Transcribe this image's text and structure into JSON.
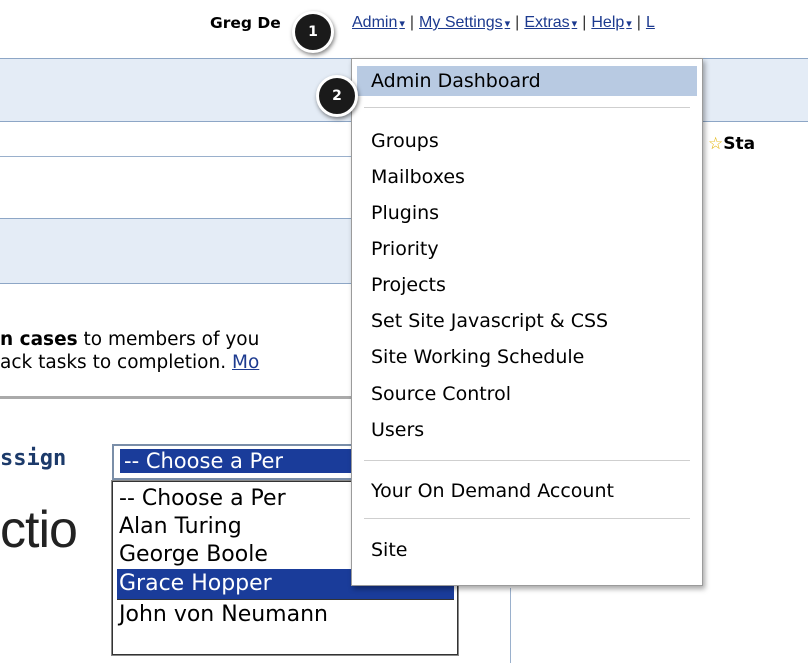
{
  "topnav": {
    "user_name": "Greg De",
    "links": [
      {
        "label": "Admin",
        "caret": "▾"
      },
      {
        "label": "My Settings",
        "caret": "▾"
      },
      {
        "label": "Extras",
        "caret": "▾"
      },
      {
        "label": "Help",
        "caret": "▾"
      },
      {
        "label": "L",
        "caret": ""
      }
    ],
    "separator": "|"
  },
  "toolbar": {
    "caret": "▾",
    "star_label": "Sta"
  },
  "intro": {
    "line1_bold": "n cases",
    "line1_rest": " to members of you",
    "line2_rest": "ack tasks to completion. ",
    "line2_link": "Mo"
  },
  "assign": {
    "label": "ssign",
    "selected": "-- Choose a Per",
    "big_text": "ctio"
  },
  "person_options": [
    {
      "label": "-- Choose a Per",
      "selected": false
    },
    {
      "label": "Alan Turing",
      "selected": false
    },
    {
      "label": "George Boole",
      "selected": false
    },
    {
      "label": "Grace Hopper",
      "selected": true
    },
    {
      "label": "John von Neumann",
      "selected": false
    }
  ],
  "admin_menu": {
    "highlighted": "Admin Dashboard",
    "group1": [
      "Groups",
      "Mailboxes",
      "Plugins",
      "Priority",
      "Projects",
      "Set Site Javascript & CSS",
      "Site Working Schedule",
      "Source Control",
      "Users"
    ],
    "group2": [
      "Your On Demand Account"
    ],
    "group3": [
      "Site"
    ]
  },
  "steps": [
    "1",
    "2"
  ],
  "colors": {
    "link": "#1c3a8f",
    "menu_highlight": "#b8cae2",
    "selection": "#1a3c9a",
    "band": "#e4ecf6"
  }
}
